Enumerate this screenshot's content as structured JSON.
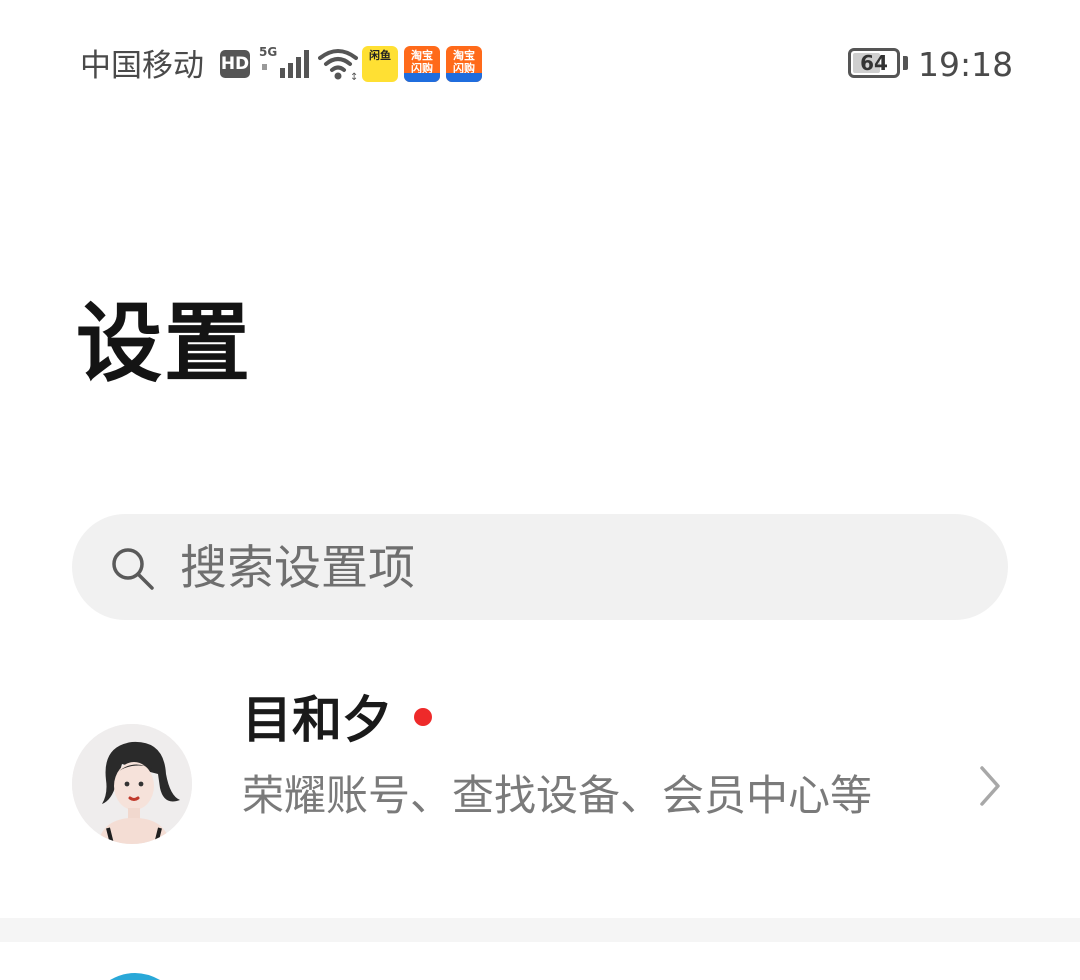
{
  "status_bar": {
    "carrier": "中国移动",
    "hd_label": "HD",
    "network_label": "5G",
    "app_icons": [
      {
        "name": "闲鱼",
        "line1": "闲鱼"
      },
      {
        "name": "淘宝闪购",
        "line1": "淘宝",
        "line2": "闪购"
      },
      {
        "name": "淘宝闪购",
        "line1": "淘宝",
        "line2": "闪购"
      }
    ],
    "battery_level": "64",
    "time": "19:18"
  },
  "page": {
    "title": "设置"
  },
  "search": {
    "placeholder": "搜索设置项",
    "icon": "search-icon"
  },
  "account": {
    "name": "目和夕",
    "description": "荣耀账号、查找设备、会员中心等",
    "has_notification": true,
    "avatar_icon": "avatar",
    "chevron_icon": "chevron-right-icon"
  },
  "colors": {
    "background": "#ffffff",
    "search_background": "#f1f1f1",
    "title_text": "#141414",
    "secondary_text": "#7a7a7a",
    "notification_dot": "#ee2a2a",
    "divider": "#f5f5f5"
  }
}
